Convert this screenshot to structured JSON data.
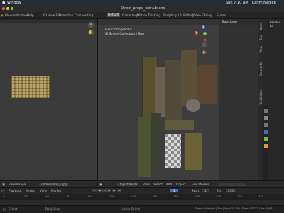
{
  "mac_menubar": {
    "app": "Window",
    "time": "Sun 7:10 AM",
    "user": "Karim Nagieb"
  },
  "window_title": "Street_props_extra.blend",
  "menu": [
    "Blender",
    "Window",
    "Help",
    "3D View Full",
    "Animation",
    "Compositing",
    "Default",
    "Game Logic",
    "Motion Tracking",
    "Scripting",
    "UV Editing",
    "Video Editing",
    "Scene"
  ],
  "active_workspace": "Default",
  "viewport": {
    "overlay_line1": "User Orthographic",
    "overlay_line2": "(4) Scene Collection | Sun",
    "mode": "Object Mode",
    "menus": [
      "View",
      "Select",
      "Add",
      "Object"
    ],
    "pivot": "Find Models"
  },
  "n_panel_label": "Transform",
  "side_tabs": [
    "Item",
    "Tool",
    "View",
    "BlenderKit",
    "Flexibilities"
  ],
  "outliner_label": "Render La",
  "image_editor": {
    "menus": [
      "View",
      "Image"
    ],
    "image_name": "underscore_h.jpg"
  },
  "timeline": {
    "menus": [
      "Playback",
      "Keying",
      "View",
      "Marker"
    ],
    "current_frame": "1",
    "start": "1",
    "end": "250",
    "start_label": "Start",
    "end_label": "End"
  },
  "ruler_ticks": [
    "0",
    "20",
    "40",
    "60",
    "80",
    "100",
    "120",
    "140",
    "160",
    "180",
    "200",
    "220",
    "240"
  ],
  "status": {
    "left": "Select",
    "mid1": "Dolly View",
    "mid2": "Lasso Select",
    "right": "Scene Collection | Sun | Verts:15,265 | Faces:14,777 | Tris:29,624"
  },
  "gizmo_axes": [
    "X",
    "Y",
    "Z"
  ],
  "colors": {
    "accent": "#3d6ebf",
    "x_axis": "#e14a4a",
    "y_axis": "#6fbf3f",
    "z_axis": "#3f7de1"
  }
}
